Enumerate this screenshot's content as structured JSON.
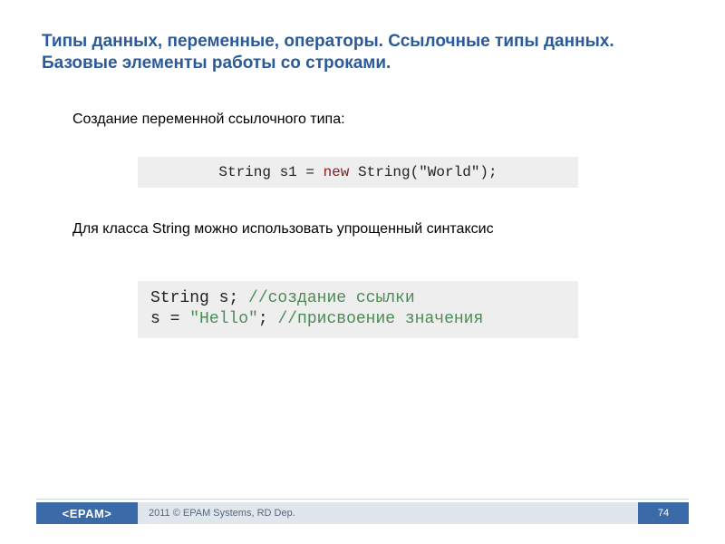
{
  "title": "Типы данных, переменные, операторы. Ссылочные типы данных. Базовые элементы работы со строками.",
  "intro": "Создание переменной ссылочного типа:",
  "code1": {
    "before": "String s1 = ",
    "keyword": "new",
    "after": " String(\"World\");"
  },
  "subtext": "Для класса String можно использовать упрощенный синтаксис",
  "code2": {
    "line1_code": "String s; ",
    "line1_comment": "//создание ссылки",
    "line2_code_a": "s = ",
    "line2_string": "\"Hello\"",
    "line2_code_b": "; ",
    "line2_comment": "//присвоение значения"
  },
  "footer": {
    "logo": "<EPAM>",
    "copyright": "2011 © EPAM Systems, RD Dep.",
    "page": "74"
  }
}
